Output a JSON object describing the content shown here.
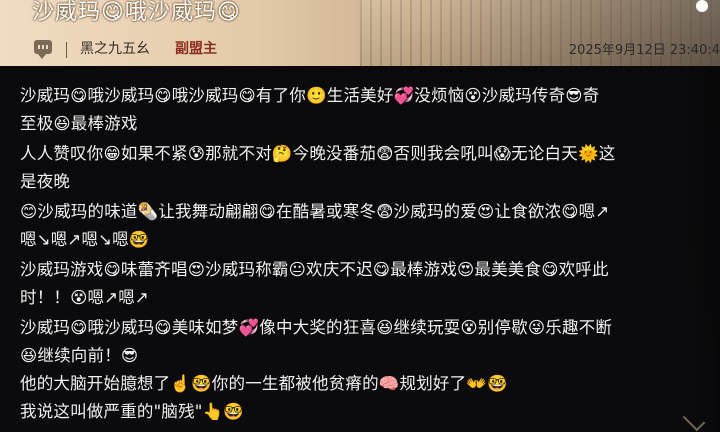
{
  "post": {
    "title": "沙威玛😋哦沙威玛😋",
    "username": "黑之九五幺",
    "role": "副盟主",
    "timestamp": "2025年9月12日 23:40:4"
  },
  "content_lines": [
    "沙威玛😋哦沙威玛😋哦沙威玛😋有了你🙂生活美好💞没烦恼😵沙威玛传奇😎奇",
    "至极😆最棒游戏",
    "人人赞叹你😁如果不紧😰那就不对🤔今晚没番茄😨否则我会吼叫😱无论白天🌞这",
    "是夜晚",
    "😊沙威玛的味道🌯让我舞动翩翩😋在酷暑或寒冬😨沙威玛的爱😍让食欲浓😋嗯↗",
    "嗯↘嗯↗嗯↘嗯🤓",
    "沙威玛游戏😋味蕾齐唱😍沙威玛称霸😐欢庆不迟😋最棒游戏😍最美美食😋欢呼此",
    "时！！😵嗯↗嗯↗",
    "沙威玛😋哦沙威玛😋美味如梦💞像中大奖的狂喜😆继续玩耍😵别停歇😜乐趣不断",
    "😆继续向前！😎",
    "他的大脑开始臆想了☝️🤓你的一生都被他贫瘠的🧠规划好了👐🤓",
    "我说这叫做严重的\"脑残\"👆🤓"
  ],
  "icons": {
    "chat": "chat-bubble-icon",
    "top_right": "dot-icon",
    "bottom_right": "chevron-down-icon"
  },
  "colors": {
    "role": "#8b2e1f",
    "text": "#f0f0f0"
  }
}
